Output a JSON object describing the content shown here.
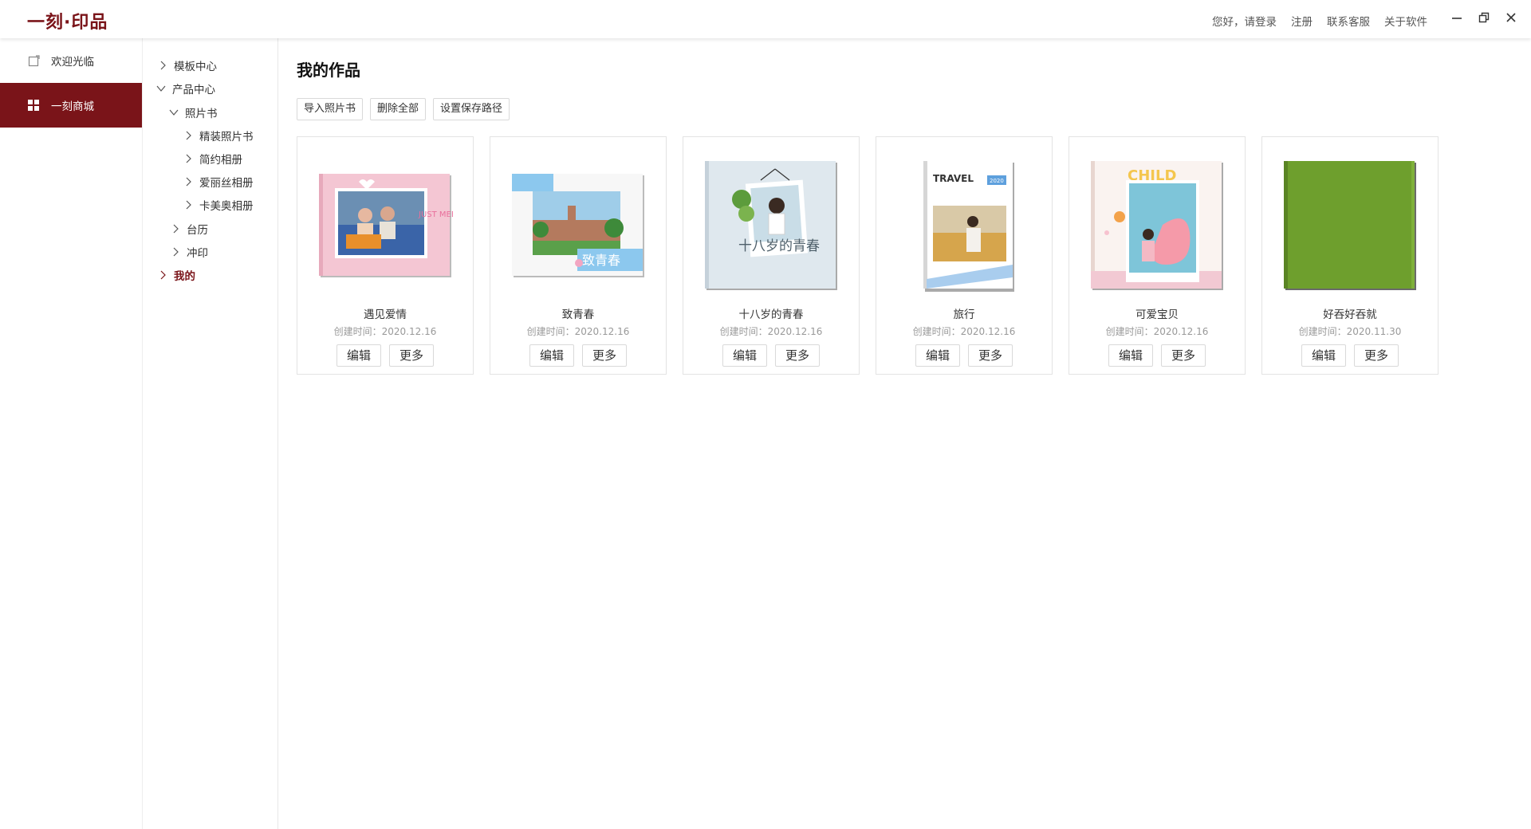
{
  "app": {
    "logo": "一刻·印品"
  },
  "top_links": [
    "您好，请登录",
    "注册",
    "联系客服",
    "关于软件"
  ],
  "sidebar": {
    "items": [
      {
        "label": "欢迎光临",
        "icon": "page-icon",
        "active": false
      },
      {
        "label": "一刻商城",
        "icon": "grid-icon",
        "active": true
      }
    ]
  },
  "tree": {
    "template_center": "模板中心",
    "product_center": "产品中心",
    "photobook": "照片书",
    "hardcover": "精装照片书",
    "simple_album": "简约相册",
    "alice_album": "爱丽丝相册",
    "kamei_album": "卡美奥相册",
    "calendar": "台历",
    "print": "冲印",
    "mine": "我的"
  },
  "main": {
    "title": "我的作品",
    "toolbar": {
      "import": "导入照片书",
      "delete_all": "删除全部",
      "save_path": "设置保存路径"
    },
    "works": [
      {
        "name": "遇见爱情",
        "date": "创建时间：2020.12.16"
      },
      {
        "name": "致青春",
        "date": "创建时间：2020.12.16"
      },
      {
        "name": "十八岁的青春",
        "date": "创建时间：2020.12.16"
      },
      {
        "name": "旅行",
        "date": "创建时间：2020.12.16"
      },
      {
        "name": "可爱宝贝",
        "date": "创建时间：2020.12.16"
      },
      {
        "name": "好吞好吞就",
        "date": "创建时间：2020.11.30"
      }
    ],
    "edit_label": "编辑",
    "more_label": "更多"
  },
  "cover_text": {
    "cover1_text": "JUST MEET YOU",
    "cover2_text": "致青春",
    "cover3_text": "十八岁的青春",
    "cover4_title": "TRAVEL",
    "cover4_year": "2020",
    "cover5_text": "CHILD"
  },
  "colors": {
    "brand": "#7a1419",
    "green_cover": "#6e9f2d"
  }
}
